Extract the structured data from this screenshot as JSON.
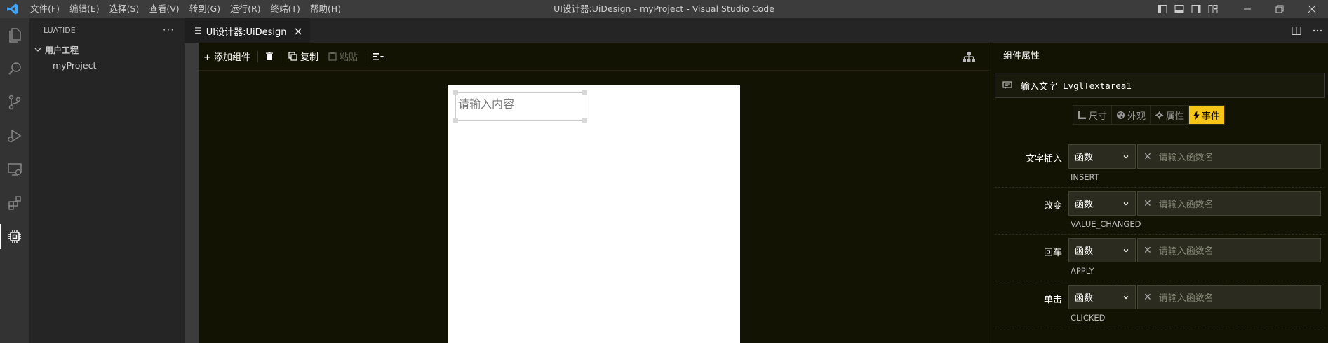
{
  "titlebar": {
    "menu": [
      "文件(F)",
      "编辑(E)",
      "选择(S)",
      "查看(V)",
      "转到(G)",
      "运行(R)",
      "终端(T)",
      "帮助(H)"
    ],
    "window_title": "UI设计器:UiDesign - myProject - Visual Studio Code"
  },
  "sidebar": {
    "header": "LUATIDE",
    "more": "···",
    "root": "用户工程",
    "items": [
      "myProject"
    ]
  },
  "tab": {
    "label": "UI设计器:UiDesign",
    "close": "×"
  },
  "toolbar": {
    "add_component": "+ 添加组件",
    "copy": "复制",
    "paste": "粘贴"
  },
  "canvas": {
    "textarea_placeholder": "请输入内容"
  },
  "props": {
    "title": "组件属性",
    "component_label": "输入文字",
    "component_name": "LvglTextarea1",
    "tabs": [
      {
        "label": "尺寸",
        "icon": "ruler-icon"
      },
      {
        "label": "外观",
        "icon": "palette-icon"
      },
      {
        "label": "属性",
        "icon": "settings-icon"
      },
      {
        "label": "事件",
        "icon": "lightning-icon"
      }
    ],
    "active_tab": "事件",
    "events": [
      {
        "label": "文字插入",
        "type": "函数",
        "placeholder": "请输入函数名",
        "code": "INSERT"
      },
      {
        "label": "改变",
        "type": "函数",
        "placeholder": "请输入函数名",
        "code": "VALUE_CHANGED"
      },
      {
        "label": "回车",
        "type": "函数",
        "placeholder": "请输入函数名",
        "code": "APPLY"
      },
      {
        "label": "单击",
        "type": "函数",
        "placeholder": "请输入函数名",
        "code": "CLICKED"
      }
    ]
  },
  "colors": {
    "accent": "#f5c518",
    "vscode_blue": "#3ea6ff",
    "editor_bg": "#131303"
  }
}
